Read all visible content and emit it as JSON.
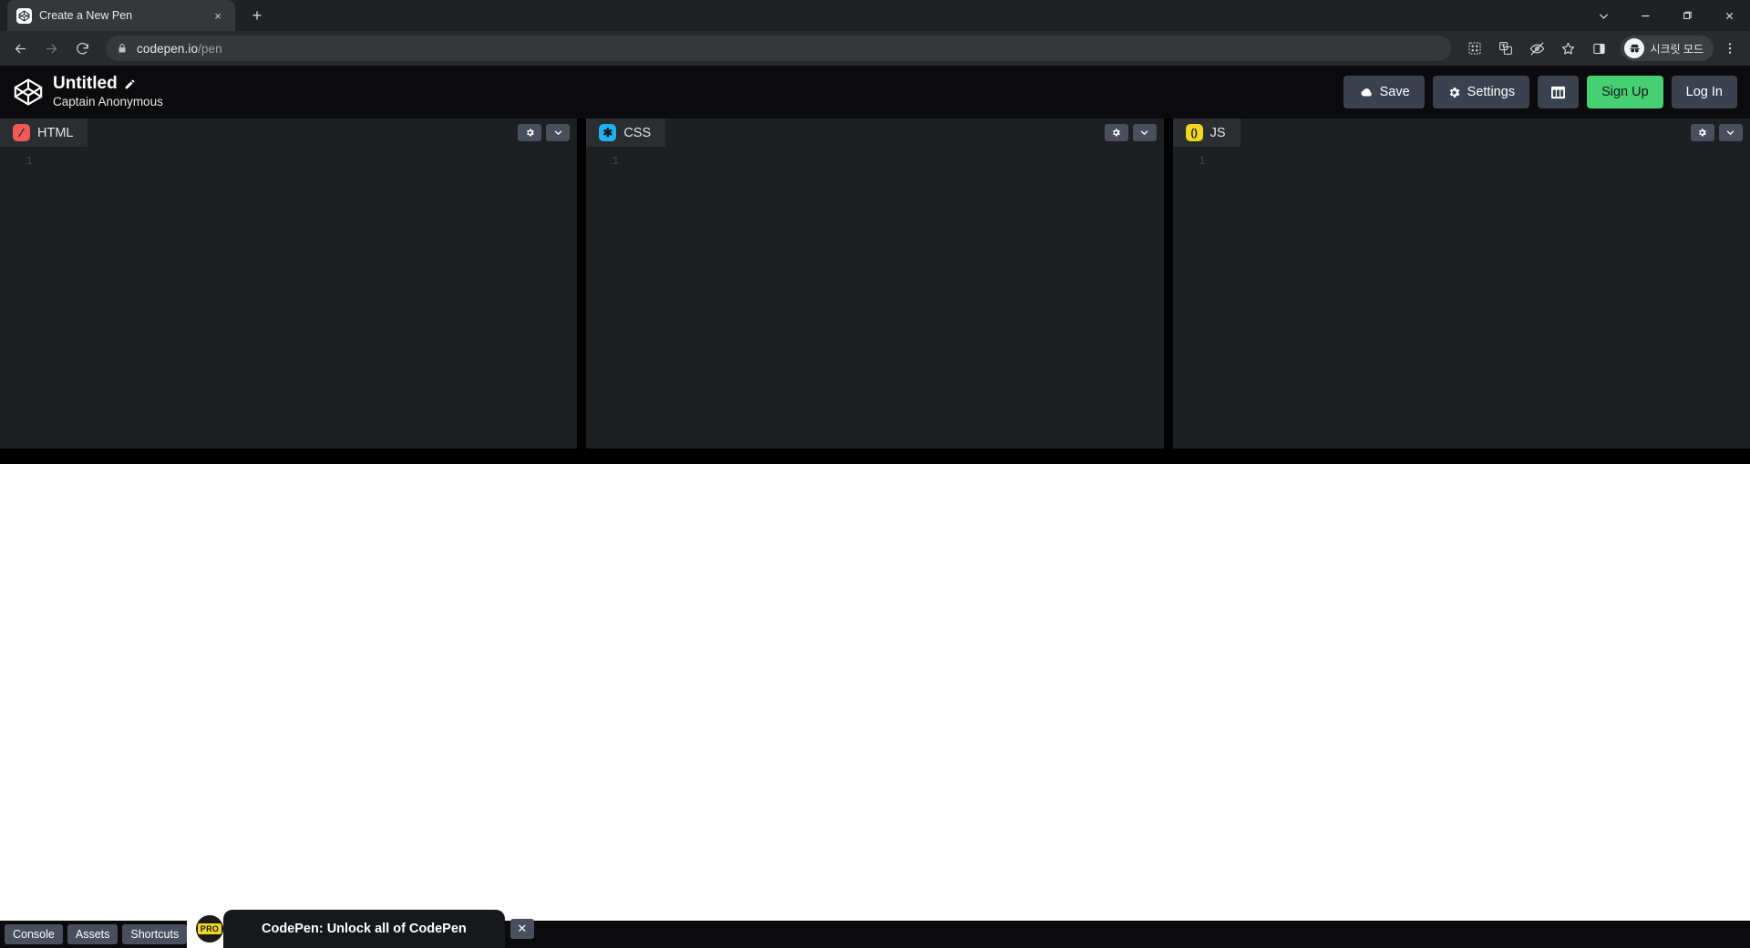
{
  "browser": {
    "tab": {
      "title": "Create a New Pen",
      "favicon": "codepen-logo-icon",
      "close_label": "×"
    },
    "new_tab_label": "+",
    "window_controls": [
      {
        "name": "chevron-down-icon",
        "label": "∨"
      },
      {
        "name": "minimize-icon",
        "label": "—"
      },
      {
        "name": "maximize-icon",
        "label": "❐"
      },
      {
        "name": "close-icon",
        "label": "✕"
      }
    ],
    "nav": {
      "back": "←",
      "forward": "→",
      "reload": "⟳"
    },
    "url": {
      "domain": "codepen.io",
      "path": "/pen",
      "lock_icon": "lock-icon"
    },
    "toolbar_icons": [
      {
        "name": "qr-code-icon"
      },
      {
        "name": "translate-icon"
      },
      {
        "name": "eye-off-icon"
      },
      {
        "name": "bookmark-star-icon"
      },
      {
        "name": "side-panel-icon"
      }
    ],
    "incognito": {
      "label": "시크릿 모드",
      "icon": "incognito-icon"
    },
    "menu_icon": "three-dot-menu-icon"
  },
  "pen": {
    "logo": "codepen-logo-icon",
    "title": "Untitled",
    "edit_icon": "pencil-icon",
    "author": "Captain Anonymous",
    "actions": [
      {
        "name": "save-button",
        "label": "Save",
        "icon": "cloud-icon",
        "style": "default"
      },
      {
        "name": "settings-button",
        "label": "Settings",
        "icon": "gear-icon",
        "style": "default"
      },
      {
        "name": "layout-button",
        "label": "",
        "icon": "layout-grid-icon",
        "style": "icon"
      },
      {
        "name": "sign-up-button",
        "label": "Sign Up",
        "icon": "",
        "style": "signup"
      },
      {
        "name": "log-in-button",
        "label": "Log In",
        "icon": "",
        "style": "default"
      }
    ]
  },
  "editors": [
    {
      "lang": "HTML",
      "icon": "html-icon",
      "icon_glyph": "∕",
      "icon_bg": "#f2585b",
      "line_number": "1",
      "code": ""
    },
    {
      "lang": "CSS",
      "icon": "css-icon",
      "icon_glyph": "✱",
      "icon_bg": "#1cb2f5",
      "line_number": "1",
      "code": ""
    },
    {
      "lang": "JS",
      "icon": "js-icon",
      "icon_glyph": "()",
      "icon_bg": "#f0d722",
      "line_number": "1",
      "code": ""
    }
  ],
  "pane_tools": {
    "settings_icon": "gear-icon",
    "collapse_icon": "chevron-down-icon"
  },
  "bottom_bar": {
    "buttons": [
      {
        "name": "console-button",
        "label": "Console"
      },
      {
        "name": "assets-button",
        "label": "Assets"
      },
      {
        "name": "shortcuts-button",
        "label": "Shortcuts"
      }
    ]
  },
  "toast": {
    "badge_text": "PRO",
    "message": "CodePen: Unlock all of CodePen",
    "close_label": "✕"
  },
  "colors": {
    "accent_green": "#47cf73",
    "html": "#f2585b",
    "css": "#1cb2f5",
    "js": "#f0d722",
    "chrome_bg": "#202124",
    "editor_bg": "#1d1f21"
  }
}
